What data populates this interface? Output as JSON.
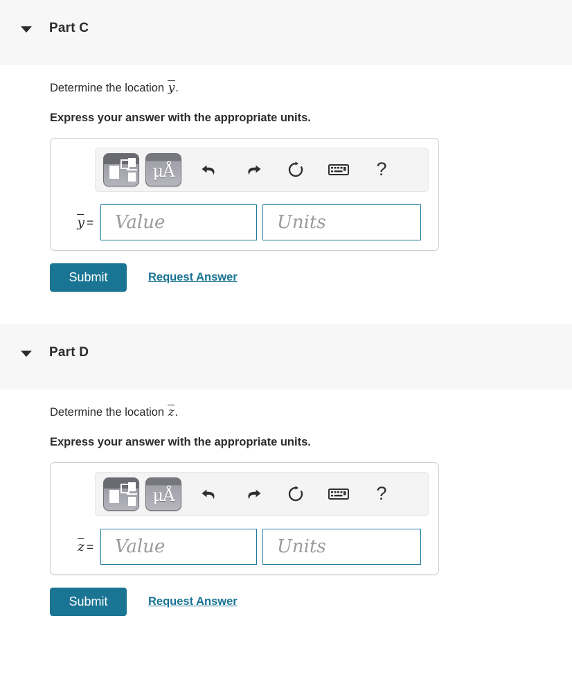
{
  "page": {
    "accent_color": "#1a7494",
    "header_bg": "#f7f7f7",
    "field_border_color": "#1d7a9c",
    "placeholder_color": "#9b9b9b"
  },
  "toolbar": {
    "buttons": [
      {
        "name": "math-template-button",
        "label": "",
        "icon": "math-template-icon",
        "tooltip": "Math templates"
      },
      {
        "name": "units-button",
        "label": "μÅ",
        "icon": "units-icon",
        "tooltip": "Units"
      },
      {
        "name": "undo-button",
        "label": "",
        "icon": "undo-icon",
        "tooltip": "Undo"
      },
      {
        "name": "redo-button",
        "label": "",
        "icon": "redo-icon",
        "tooltip": "Redo"
      },
      {
        "name": "reset-button",
        "label": "",
        "icon": "reset-icon",
        "tooltip": "Reset"
      },
      {
        "name": "keyboard-button",
        "label": "",
        "icon": "keyboard-icon",
        "tooltip": "Keyboard shortcuts"
      },
      {
        "name": "help-button",
        "label": "?",
        "icon": "question-mark-icon",
        "tooltip": "Help"
      }
    ]
  },
  "parts": [
    {
      "id": "part-c",
      "title": "Part C",
      "caret": "caret-down-icon",
      "prompt_prefix": "Determine the location ",
      "prompt_variable": "y",
      "prompt_suffix": ".",
      "instruction": "Express your answer with the appropriate units.",
      "variable_label": "y",
      "equals": "=",
      "value_placeholder": "Value",
      "units_placeholder": "Units",
      "value_current": "",
      "units_current": "",
      "submit_label": "Submit",
      "request_answer_label": "Request Answer"
    },
    {
      "id": "part-d",
      "title": "Part D",
      "caret": "caret-down-icon",
      "prompt_prefix": "Determine the location ",
      "prompt_variable": "z",
      "prompt_suffix": ".",
      "instruction": "Express your answer with the appropriate units.",
      "variable_label": "z",
      "equals": "=",
      "value_placeholder": "Value",
      "units_placeholder": "Units",
      "value_current": "",
      "units_current": "",
      "submit_label": "Submit",
      "request_answer_label": "Request Answer"
    }
  ]
}
